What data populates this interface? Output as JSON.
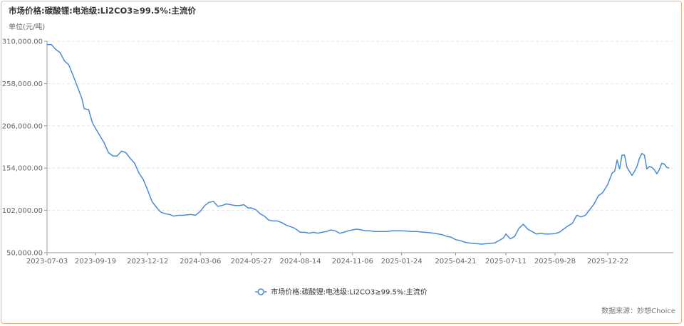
{
  "header": {
    "title": "市场价格:碳酸锂:电池级:Li2CO3≥99.5%:主流价",
    "unit": "单位(元/吨)"
  },
  "footer": {
    "source": "数据来源：妙想Choice"
  },
  "colors": {
    "line": "#4a8ad6",
    "grid": "#e6e6e6",
    "axis": "#999999",
    "border": "#f4b183"
  },
  "chart_data": {
    "type": "line",
    "title": "市场价格:碳酸锂:电池级:Li2CO3≥99.5%:主流价",
    "ylabel": "单位(元/吨)",
    "ylim": [
      50000,
      310000
    ],
    "yticks": [
      "50,000.00",
      "102,000.00",
      "154,000.00",
      "206,000.00",
      "258,000.00",
      "310,000.00"
    ],
    "ytick_values": [
      50000,
      102000,
      154000,
      206000,
      258000,
      310000
    ],
    "xticks": [
      "2023-07-03",
      "2023-09-19",
      "2023-12-12",
      "2024-03-06",
      "2024-05-27",
      "2024-08-14",
      "2024-11-06",
      "2025-01-24",
      "2025-04-21",
      "2025-07-11",
      "2025-09-28",
      "2025-12-22"
    ],
    "grid": true,
    "legend_position": "bottom",
    "series": [
      {
        "name": "市场价格:碳酸锂:电池级:Li2CO3≥99.5%:主流价",
        "points": [
          [
            "2023-07-03",
            306000
          ],
          [
            "2023-07-10",
            306000
          ],
          [
            "2023-07-17",
            300000
          ],
          [
            "2023-07-24",
            296000
          ],
          [
            "2023-07-31",
            286000
          ],
          [
            "2023-08-07",
            281000
          ],
          [
            "2023-08-14",
            268000
          ],
          [
            "2023-08-21",
            254000
          ],
          [
            "2023-08-28",
            240000
          ],
          [
            "2023-09-01",
            227000
          ],
          [
            "2023-09-08",
            226000
          ],
          [
            "2023-09-14",
            210000
          ],
          [
            "2023-09-19",
            203000
          ],
          [
            "2023-09-26",
            194000
          ],
          [
            "2023-10-03",
            185000
          ],
          [
            "2023-10-10",
            173000
          ],
          [
            "2023-10-17",
            169000
          ],
          [
            "2023-10-24",
            169000
          ],
          [
            "2023-10-31",
            175000
          ],
          [
            "2023-11-07",
            173000
          ],
          [
            "2023-11-14",
            166000
          ],
          [
            "2023-11-21",
            160000
          ],
          [
            "2023-11-28",
            148000
          ],
          [
            "2023-12-05",
            140000
          ],
          [
            "2023-12-12",
            127000
          ],
          [
            "2023-12-19",
            113000
          ],
          [
            "2023-12-26",
            106000
          ],
          [
            "2024-01-02",
            100000
          ],
          [
            "2024-01-09",
            98000
          ],
          [
            "2024-01-16",
            97000
          ],
          [
            "2024-01-23",
            95000
          ],
          [
            "2024-01-30",
            96000
          ],
          [
            "2024-02-06",
            96000
          ],
          [
            "2024-02-13",
            96500
          ],
          [
            "2024-02-20",
            97000
          ],
          [
            "2024-02-27",
            96000
          ],
          [
            "2024-03-06",
            101000
          ],
          [
            "2024-03-13",
            108000
          ],
          [
            "2024-03-20",
            112000
          ],
          [
            "2024-03-27",
            113000
          ],
          [
            "2024-04-03",
            107000
          ],
          [
            "2024-04-10",
            108000
          ],
          [
            "2024-04-17",
            110000
          ],
          [
            "2024-04-24",
            109000
          ],
          [
            "2024-05-01",
            108000
          ],
          [
            "2024-05-08",
            108000
          ],
          [
            "2024-05-15",
            109000
          ],
          [
            "2024-05-22",
            105000
          ],
          [
            "2024-05-27",
            105000
          ],
          [
            "2024-06-03",
            103000
          ],
          [
            "2024-06-10",
            98000
          ],
          [
            "2024-06-17",
            95000
          ],
          [
            "2024-06-24",
            90000
          ],
          [
            "2024-07-01",
            89000
          ],
          [
            "2024-07-08",
            89000
          ],
          [
            "2024-07-15",
            87000
          ],
          [
            "2024-07-22",
            84000
          ],
          [
            "2024-07-29",
            82000
          ],
          [
            "2024-08-05",
            80000
          ],
          [
            "2024-08-14",
            75000
          ],
          [
            "2024-08-21",
            75000
          ],
          [
            "2024-08-28",
            74000
          ],
          [
            "2024-09-04",
            75000
          ],
          [
            "2024-09-11",
            74000
          ],
          [
            "2024-09-18",
            75000
          ],
          [
            "2024-09-25",
            76000
          ],
          [
            "2024-10-02",
            78000
          ],
          [
            "2024-10-09",
            77000
          ],
          [
            "2024-10-16",
            74000
          ],
          [
            "2024-10-23",
            75000
          ],
          [
            "2024-10-30",
            77000
          ],
          [
            "2024-11-06",
            78000
          ],
          [
            "2024-11-13",
            79000
          ],
          [
            "2024-11-20",
            78000
          ],
          [
            "2024-11-27",
            77000
          ],
          [
            "2024-12-04",
            77000
          ],
          [
            "2024-12-11",
            76000
          ],
          [
            "2024-12-18",
            76000
          ],
          [
            "2024-12-25",
            76000
          ],
          [
            "2025-01-01",
            76000
          ],
          [
            "2025-01-08",
            77000
          ],
          [
            "2025-01-15",
            77000
          ],
          [
            "2025-01-24",
            77000
          ],
          [
            "2025-02-03",
            76500
          ],
          [
            "2025-02-10",
            76000
          ],
          [
            "2025-02-17",
            76000
          ],
          [
            "2025-02-24",
            75500
          ],
          [
            "2025-03-03",
            75000
          ],
          [
            "2025-03-10",
            74500
          ],
          [
            "2025-03-17",
            74000
          ],
          [
            "2025-03-24",
            73000
          ],
          [
            "2025-03-31",
            72000
          ],
          [
            "2025-04-07",
            70000
          ],
          [
            "2025-04-14",
            69000
          ],
          [
            "2025-04-21",
            66000
          ],
          [
            "2025-04-28",
            65000
          ],
          [
            "2025-05-05",
            63000
          ],
          [
            "2025-05-12",
            62000
          ],
          [
            "2025-05-19",
            61500
          ],
          [
            "2025-05-26",
            61000
          ],
          [
            "2025-06-02",
            60500
          ],
          [
            "2025-06-09",
            61000
          ],
          [
            "2025-06-16",
            61500
          ],
          [
            "2025-06-23",
            62000
          ],
          [
            "2025-06-30",
            65000
          ],
          [
            "2025-07-07",
            68000
          ],
          [
            "2025-07-11",
            73000
          ],
          [
            "2025-07-18",
            67000
          ],
          [
            "2025-07-25",
            70000
          ],
          [
            "2025-08-01",
            80000
          ],
          [
            "2025-08-08",
            85000
          ],
          [
            "2025-08-15",
            79000
          ],
          [
            "2025-08-22",
            76000
          ],
          [
            "2025-08-29",
            73000
          ],
          [
            "2025-09-05",
            74000
          ],
          [
            "2025-09-12",
            73000
          ],
          [
            "2025-09-19",
            73000
          ],
          [
            "2025-09-28",
            73500
          ],
          [
            "2025-10-05",
            75000
          ],
          [
            "2025-10-12",
            79000
          ],
          [
            "2025-10-19",
            83000
          ],
          [
            "2025-10-26",
            86000
          ],
          [
            "2025-11-02",
            96000
          ],
          [
            "2025-11-09",
            94000
          ],
          [
            "2025-11-16",
            96000
          ],
          [
            "2025-11-23",
            103000
          ],
          [
            "2025-11-30",
            110000
          ],
          [
            "2025-12-07",
            120000
          ],
          [
            "2025-12-14",
            124000
          ],
          [
            "2025-12-22",
            134000
          ],
          [
            "2025-12-29",
            148000
          ],
          [
            "2026-01-02",
            150000
          ],
          [
            "2026-01-06",
            164000
          ],
          [
            "2026-01-10",
            153000
          ],
          [
            "2026-01-14",
            170000
          ],
          [
            "2026-01-18",
            170000
          ],
          [
            "2026-01-22",
            155000
          ],
          [
            "2026-01-26",
            150000
          ],
          [
            "2026-01-30",
            145000
          ],
          [
            "2026-02-03",
            150000
          ],
          [
            "2026-02-07",
            156000
          ],
          [
            "2026-02-11",
            166000
          ],
          [
            "2026-02-15",
            172000
          ],
          [
            "2026-02-19",
            170000
          ],
          [
            "2026-02-23",
            153000
          ],
          [
            "2026-02-27",
            156000
          ],
          [
            "2026-03-03",
            155000
          ],
          [
            "2026-03-07",
            152000
          ],
          [
            "2026-03-11",
            147000
          ],
          [
            "2026-03-15",
            152000
          ],
          [
            "2026-03-19",
            160000
          ],
          [
            "2026-03-23",
            159000
          ],
          [
            "2026-03-27",
            155000
          ],
          [
            "2026-03-31",
            154000
          ]
        ]
      }
    ]
  }
}
